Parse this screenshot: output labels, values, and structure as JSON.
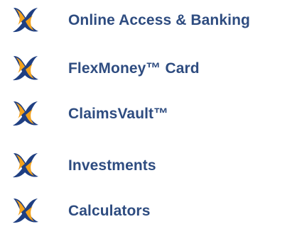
{
  "menu": {
    "items": [
      {
        "label": "Online Access & Banking",
        "icon": "x-logo-icon"
      },
      {
        "label": "FlexMoney™ Card",
        "icon": "x-logo-icon"
      },
      {
        "label": "ClaimsVault™",
        "icon": "x-logo-icon"
      },
      {
        "label": "Investments",
        "icon": "x-logo-icon"
      },
      {
        "label": "Calculators",
        "icon": "x-logo-icon"
      }
    ]
  },
  "colors": {
    "label": "#2e4c80",
    "logo_blue": "#1f3f82",
    "logo_orange": "#f3a21c",
    "background": "#ffffff"
  }
}
